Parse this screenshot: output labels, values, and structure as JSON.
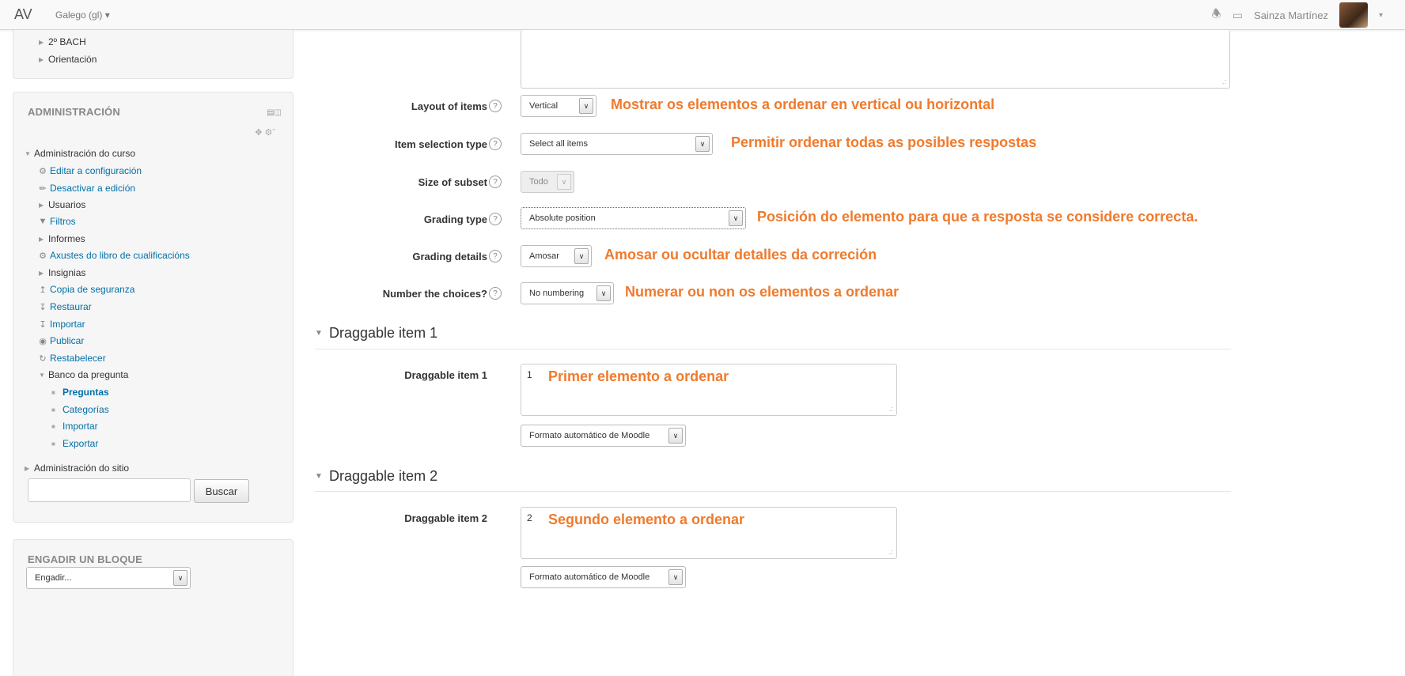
{
  "navbar": {
    "brand": "AV",
    "language": "Galego (gl) ▾",
    "user_name": "Sainza Martínez",
    "caret": "▾",
    "icons": [
      "bell-icon",
      "chat-bubble-icon"
    ]
  },
  "sidebar": {
    "nav_items": [
      "2º BACH",
      "Orientación"
    ],
    "admin": {
      "title": "ADMINISTRACIÓN",
      "course_admin": "Administración do curso",
      "items": [
        "Editar a configuración",
        "Desactivar a edición",
        "Usuarios",
        "Filtros",
        "Informes",
        "Axustes do libro de cualificacións",
        "Insignias",
        "Copia de seguranza",
        "Restaurar",
        "Importar",
        "Publicar",
        "Restabelecer",
        "Banco da pregunta"
      ],
      "bank_items": [
        "Preguntas",
        "Categorías",
        "Importar",
        "Exportar"
      ],
      "site_admin": "Administración do sitio",
      "search_button": "Buscar",
      "search_value": ""
    },
    "add_block": {
      "title": "ENGADIR UN BLOQUE",
      "select_value": "Engadir..."
    }
  },
  "form": {
    "fields": {
      "layout": {
        "label": "Layout of items",
        "value": "Vertical",
        "note": "Mostrar os elementos a ordenar en vertical ou horizontal"
      },
      "selection": {
        "label": "Item selection type",
        "value": "Select all items",
        "note": "Permitir ordenar todas as posibles respostas"
      },
      "subset": {
        "label": "Size of subset",
        "value": "Todo"
      },
      "grading": {
        "label": "Grading type",
        "value": "Absolute position",
        "note": "Posición do elemento para que a resposta se considere correcta."
      },
      "details": {
        "label": "Grading details",
        "value": "Amosar",
        "note": "Amosar ou ocultar detalles da correción"
      },
      "numbering": {
        "label": "Number the choices?",
        "value": "No numbering",
        "note": "Numerar ou non os elementos a ordenar"
      }
    },
    "sections": [
      {
        "heading": "Draggable item 1",
        "label": "Draggable item 1",
        "value": "1",
        "note": "Primer elemento a ordenar",
        "format": "Formato automático de Moodle"
      },
      {
        "heading": "Draggable item 2",
        "label": "Draggable item 2",
        "value": "2",
        "note": "Segundo elemento a ordenar",
        "format": "Formato automático de Moodle"
      }
    ],
    "help_glyph": "?"
  },
  "colors": {
    "annotation": "#f07a2c",
    "link": "#0070a8"
  }
}
